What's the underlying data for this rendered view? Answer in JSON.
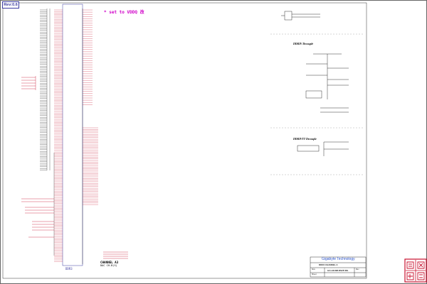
{
  "document": {
    "revision_label": "Rev:0.6",
    "ic_label": "DDR3",
    "channel_label": "CHANNEL A3",
    "bank_label": "DAC  CH-B(S)",
    "note_vddq": "* set  to VDDQ",
    "note_vddq_cn": "改",
    "sections": {
      "vddr": "DDR3V Decouple",
      "vtt": "DDR3VTT Decouple"
    },
    "title_block": {
      "company": "Gigabyte Technology",
      "title": "DDR4 CHANNEL A",
      "model": "GA-H110M-DS2P-RG",
      "sheet_label": "Sheet",
      "size_label": "Size",
      "rev_label": "Rev"
    },
    "colors": {
      "wire": "#000000",
      "pin_red": "#c8102e",
      "note_magenta": "#d000c8",
      "dash": "#9a9a9a",
      "company_blue": "#2850c8",
      "stamp_red": "#c8102e"
    }
  }
}
